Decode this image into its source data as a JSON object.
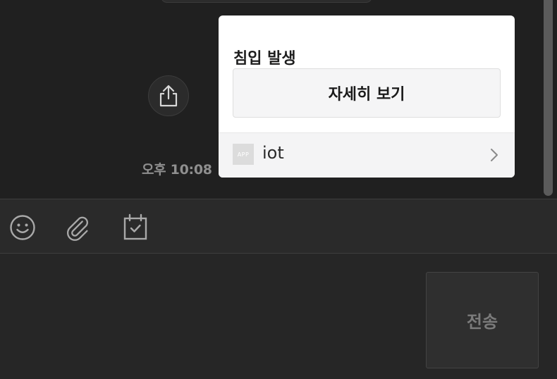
{
  "chat": {
    "timestamp": "오후 10:08"
  },
  "card": {
    "title": "침입 발생",
    "detail_button_label": "자세히 보기",
    "app_badge": "APP",
    "app_name": "iot"
  },
  "toolbar": {
    "icons": [
      "emoji-icon",
      "paperclip-icon",
      "calendar-check-icon"
    ]
  },
  "composer": {
    "input_value": "",
    "send_label": "전송"
  },
  "colors": {
    "background": "#202020",
    "card": "#ffffff",
    "send_text": "#7b7b7b"
  }
}
